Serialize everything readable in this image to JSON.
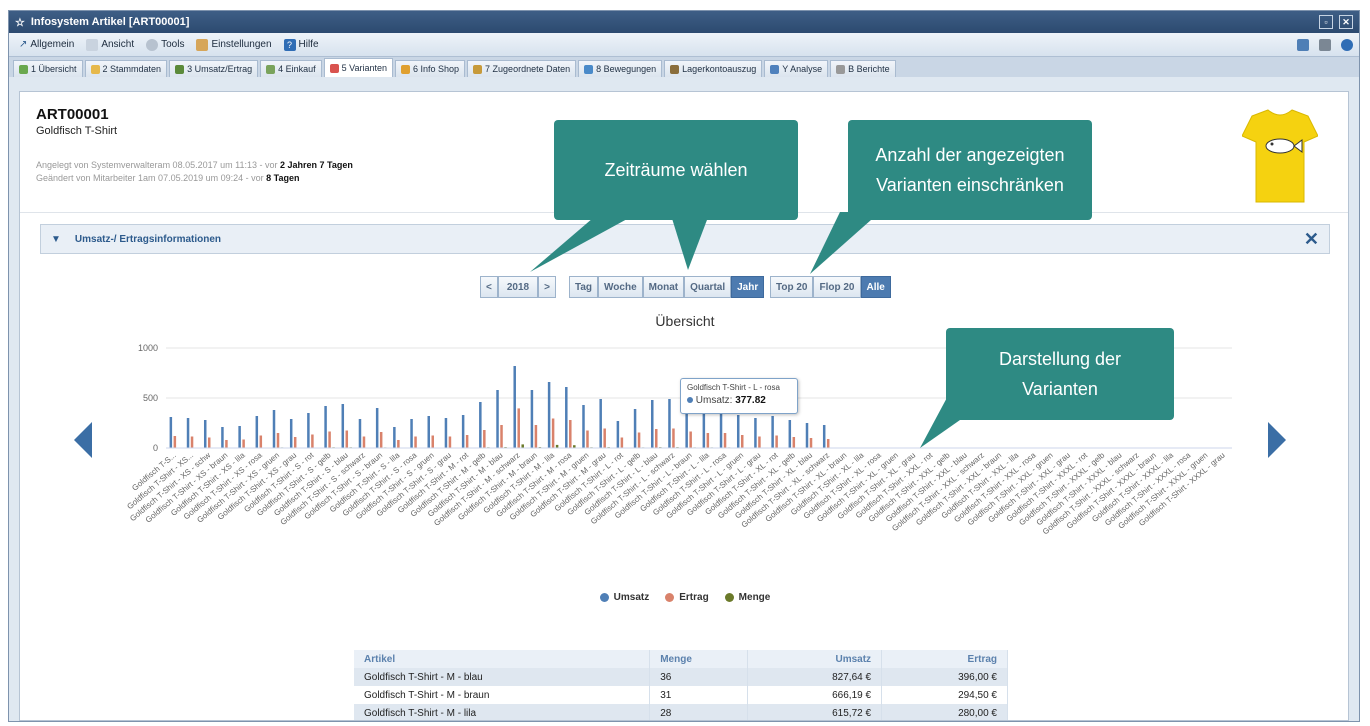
{
  "window": {
    "title": "Infosystem Artikel [ART00001]"
  },
  "menu": [
    {
      "label": "Allgemein",
      "icon": "arrow-icon"
    },
    {
      "label": "Ansicht",
      "icon": "view-icon"
    },
    {
      "label": "Tools",
      "icon": "tools-icon"
    },
    {
      "label": "Einstellungen",
      "icon": "settings-icon"
    },
    {
      "label": "Hilfe",
      "icon": "help-icon"
    }
  ],
  "tabs": [
    {
      "label": "1 Übersicht",
      "color": "#6aa84f"
    },
    {
      "label": "2 Stammdaten",
      "color": "#e6b84a"
    },
    {
      "label": "3 Umsatz/Ertrag",
      "color": "#5b8a3a"
    },
    {
      "label": "4 Einkauf",
      "color": "#7aa35c"
    },
    {
      "label": "5 Varianten",
      "color": "#d9534f",
      "active": true
    },
    {
      "label": "6 Info Shop",
      "color": "#e0a030"
    },
    {
      "label": "7 Zugeordnete Daten",
      "color": "#c79a3a"
    },
    {
      "label": "8 Bewegungen",
      "color": "#4a8ac9"
    },
    {
      "label": "Lagerkontoauszug",
      "color": "#8a6d3b"
    },
    {
      "label": "Y Analyse",
      "color": "#4f81bd"
    },
    {
      "label": "B Berichte",
      "color": "#999999"
    }
  ],
  "article": {
    "id": "ART00001",
    "name": "Goldfisch T-Shirt",
    "created_prefix": "Angelegt von Systemverwalteram 08.05.2017 um 11:13 - vor ",
    "created_age": "2 Jahren 7 Tagen",
    "changed_prefix": "Geändert von Mitarbeiter 1am 07.05.2019 um 09:24 - vor ",
    "changed_age": "8 Tagen"
  },
  "section": {
    "title": "Umsatz-/ Ertragsinformationen"
  },
  "controls": {
    "year": "2018",
    "prev": "<",
    "next": ">",
    "periods": [
      "Tag",
      "Woche",
      "Monat",
      "Quartal",
      "Jahr"
    ],
    "active_period": "Jahr",
    "filters": [
      "Top 20",
      "Flop 20",
      "Alle"
    ],
    "active_filter": "Alle"
  },
  "callouts": {
    "periods": "Zeiträume wählen",
    "filter_line1": "Anzahl der angezeigten",
    "filter_line2": "Varianten einschränken",
    "display_line1": "Darstellung der",
    "display_line2": "Varianten"
  },
  "tooltip": {
    "title": "Goldfisch T-Shirt - L - rosa",
    "label": "Umsatz:",
    "value": "377.82"
  },
  "chart_data": {
    "type": "bar",
    "title": "Übersicht",
    "ylim": [
      0,
      1000
    ],
    "yticks": [
      0,
      500,
      1000
    ],
    "colors": {
      "Umsatz": "#4f7fb6",
      "Ertrag": "#d9826b",
      "Menge": "#6b7a2a"
    },
    "categories": [
      "Goldfisch T-S...",
      "Goldfisch T-Shirt - XS...",
      "Goldfisch T-Shirt - XS - schw",
      "Goldfisch T-Shirt - XS - braun",
      "Goldfisch T-Shirt - XS - lila",
      "Goldfisch T-Shirt - XS - rosa",
      "Goldfisch T-Shirt - XS - gruen",
      "Goldfisch T-Shirt - XS - grau",
      "Goldfisch T-Shirt - S - rot",
      "Goldfisch T-Shirt - S - gelb",
      "Goldfisch T-Shirt - S - blau",
      "Goldfisch T-Shirt - S - schwarz",
      "Goldfisch T-Shirt - S - braun",
      "Goldfisch T-Shirt - S - lila",
      "Goldfisch T-Shirt - S - rosa",
      "Goldfisch T-Shirt - S - gruen",
      "Goldfisch T-Shirt - S - grau",
      "Goldfisch T-Shirt - M - rot",
      "Goldfisch T-Shirt - M - gelb",
      "Goldfisch T-Shirt - M - blau",
      "Goldfisch T-Shirt - M - schwarz",
      "Goldfisch T-Shirt - M - braun",
      "Goldfisch T-Shirt - M - lila",
      "Goldfisch T-Shirt - M - rosa",
      "Goldfisch T-Shirt - M - gruen",
      "Goldfisch T-Shirt - M - grau",
      "Goldfisch T-Shirt - L - rot",
      "Goldfisch T-Shirt - L - gelb",
      "Goldfisch T-Shirt - L - blau",
      "Goldfisch T-Shirt - L - schwarz",
      "Goldfisch T-Shirt - L - braun",
      "Goldfisch T-Shirt - L - lila",
      "Goldfisch T-Shirt - L - rosa",
      "Goldfisch T-Shirt - L - gruen",
      "Goldfisch T-Shirt - L - grau",
      "Goldfisch T-Shirt - XL - rot",
      "Goldfisch T-Shirt - XL - gelb",
      "Goldfisch T-Shirt - XL - blau",
      "Goldfisch T-Shirt - XL - schwarz",
      "Goldfisch T-Shirt - XL - braun",
      "Goldfisch T-Shirt - XL - lila",
      "Goldfisch T-Shirt - XL - rosa",
      "Goldfisch T-Shirt - XL - gruen",
      "Goldfisch T-Shirt - XL - grau",
      "Goldfisch T-Shirt - XXL - rot",
      "Goldfisch T-Shirt - XXL - gelb",
      "Goldfisch T-Shirt - XXL - blau",
      "Goldfisch T-Shirt - XXL - schwarz",
      "Goldfisch T-Shirt - XXL - braun",
      "Goldfisch T-Shirt - XXL - lila",
      "Goldfisch T-Shirt - XXL - rosa",
      "Goldfisch T-Shirt - XXL - gruen",
      "Goldfisch T-Shirt - XXL - grau",
      "Goldfisch T-Shirt - XXXL - rot",
      "Goldfisch T-Shirt - XXXL - gelb",
      "Goldfisch T-Shirt - XXXL - blau",
      "Goldfisch T-Shirt - XXXL - schwarz",
      "Goldfisch T-Shirt - XXXL - braun",
      "Goldfisch T-Shirt - XXXL - lila",
      "Goldfisch T-Shirt - XXXL - rosa",
      "Goldfisch T-Shirt - XXXL - gruen",
      "Goldfisch T-Shirt - XXXL - grau"
    ],
    "series": [
      {
        "name": "Umsatz",
        "values": [
          310,
          300,
          280,
          210,
          220,
          320,
          380,
          290,
          350,
          420,
          440,
          290,
          400,
          210,
          290,
          320,
          300,
          330,
          460,
          580,
          820,
          580,
          660,
          610,
          430,
          490,
          270,
          390,
          480,
          490,
          410,
          380,
          378,
          330,
          300,
          320,
          280,
          250,
          230,
          0,
          0,
          0,
          0,
          0,
          0,
          0,
          0,
          0,
          0,
          0,
          0,
          0,
          0,
          0,
          0,
          0,
          0,
          0,
          0,
          0,
          0,
          0
        ]
      },
      {
        "name": "Ertrag",
        "values": [
          120,
          115,
          105,
          80,
          85,
          125,
          150,
          110,
          135,
          165,
          175,
          115,
          160,
          80,
          115,
          125,
          115,
          130,
          180,
          230,
          396,
          230,
          295,
          280,
          175,
          195,
          105,
          155,
          190,
          195,
          165,
          150,
          150,
          130,
          115,
          125,
          110,
          100,
          90,
          0,
          0,
          0,
          0,
          0,
          0,
          0,
          0,
          0,
          0,
          0,
          0,
          0,
          0,
          0,
          0,
          0,
          0,
          0,
          0,
          0,
          0,
          0
        ]
      },
      {
        "name": "Menge",
        "values": [
          5,
          5,
          4,
          3,
          3,
          5,
          6,
          4,
          5,
          7,
          7,
          4,
          6,
          3,
          4,
          5,
          4,
          5,
          7,
          9,
          36,
          9,
          31,
          28,
          7,
          8,
          4,
          6,
          8,
          8,
          6,
          6,
          6,
          5,
          4,
          5,
          4,
          4,
          3,
          0,
          0,
          0,
          0,
          0,
          0,
          0,
          0,
          0,
          0,
          0,
          0,
          0,
          0,
          0,
          0,
          0,
          0,
          0,
          0,
          0,
          0,
          0
        ]
      }
    ]
  },
  "table": {
    "headers": [
      "Artikel",
      "Menge",
      "Umsatz",
      "Ertrag"
    ],
    "rows": [
      [
        "Goldfisch T-Shirt - M - blau",
        "36",
        "827,64 €",
        "396,00 €"
      ],
      [
        "Goldfisch T-Shirt - M - braun",
        "31",
        "666,19 €",
        "294,50 €"
      ],
      [
        "Goldfisch T-Shirt - M - lila",
        "28",
        "615,72 €",
        "280,00 €"
      ]
    ]
  }
}
